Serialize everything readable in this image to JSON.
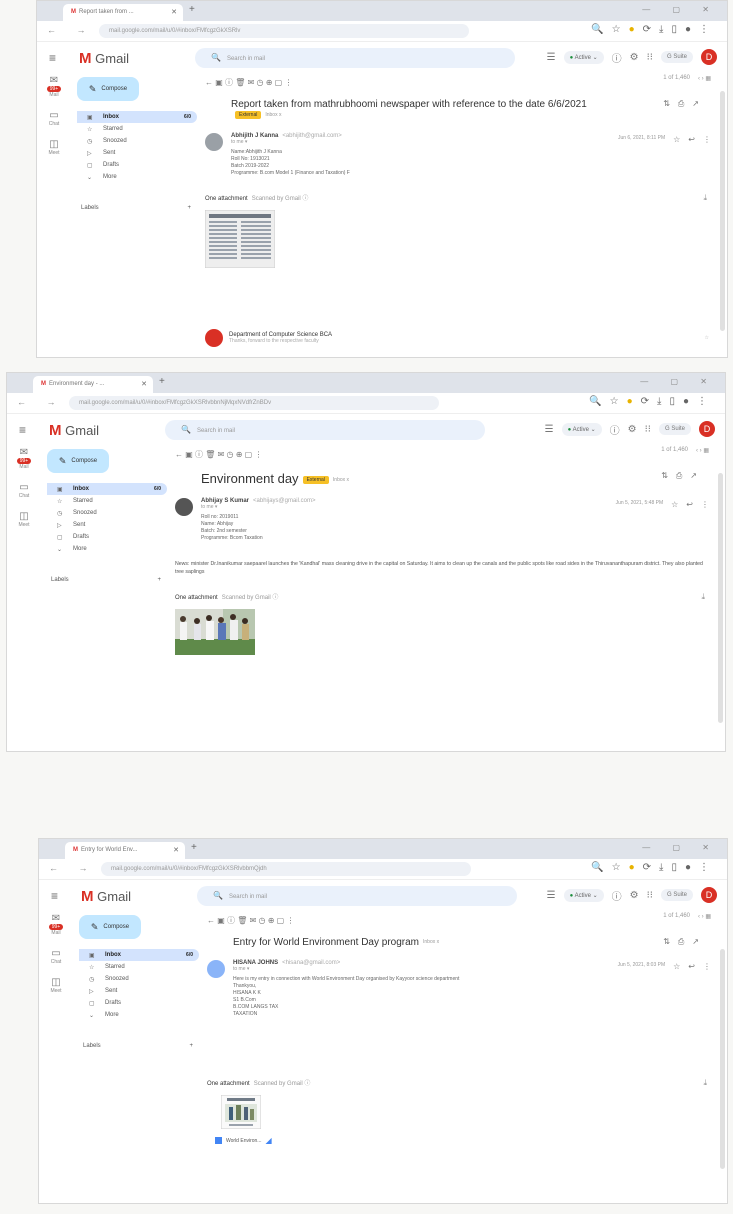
{
  "window": {
    "new_tab_symbol": "+",
    "controls": "— ▢ ✕",
    "nav": "← → ↻",
    "tune_icon": "☰"
  },
  "gmail": {
    "logo_text": "Gmail",
    "search_placeholder": "Search in mail",
    "active_label": "Active",
    "suite_label": "G Suite",
    "avatar_letter": "D",
    "compose_label": "Compose",
    "labels_heading": "Labels",
    "labels_add": "+",
    "rail": [
      {
        "label": "Mail",
        "badge": "99+"
      },
      {
        "label": "Chat"
      },
      {
        "label": "Meet"
      }
    ],
    "folders": [
      {
        "icon": "▣",
        "label": "Inbox",
        "count": "6/0"
      },
      {
        "icon": "☆",
        "label": "Starred"
      },
      {
        "icon": "◷",
        "label": "Snoozed"
      },
      {
        "icon": "▷",
        "label": "Sent"
      },
      {
        "icon": "▢",
        "label": "Drafts"
      },
      {
        "icon": "⌄",
        "label": "More"
      }
    ],
    "toolbar_icons": "← ▣ ⓘ 🗑 ✉ ◷ ⊕ ▢ ⋮",
    "pager": "1 of 1,460"
  },
  "screens": [
    {
      "tab_title": "Report taken from ...",
      "url": "mail.google.com/mail/u/0/#inbox/FMfcgzGkXSRlv",
      "subject": "Report taken from mathrubhoomi newspaper with reference to the date 6/6/2021",
      "label": "External",
      "label2": "Inbox x",
      "sender_name": "Abhijith J Kanna",
      "sender_addr": "<abhijith@gmail.com>",
      "to_line": "to me ▾",
      "body_lines": [
        "Name:Abhijith J Kanna",
        "Roll No: 1913021",
        "Batch 2019-2022",
        "Programme: B.com Model 1 (Finance and Taxation) F"
      ],
      "paragraph": "",
      "date": "Jun 6, 2021, 8:11 PM",
      "attachment_title": "One attachment",
      "attachment_note": "Scanned by Gmail ⓘ",
      "reply_name": "Department of Computer Science BCA",
      "reply_snippet": "Thanks, forward to the respective faculty"
    },
    {
      "tab_title": "Environment day - ...",
      "url": "mail.google.com/mail/u/0/#inbox/FMfcgzGkXSRlvbbnNjMqxNVdfrZnBDv",
      "subject": "Environment day",
      "label": "External",
      "label2": "Inbox x",
      "sender_name": "Abhijay S Kumar",
      "sender_addr": "<abhijays@gmail.com>",
      "to_line": "to me ▾",
      "body_lines": [
        "Roll no: 2019011",
        "Name: Abhijay",
        "Batch: 2nd semester",
        "Programme: Bcom Taxation"
      ],
      "paragraph": "News: minister Dr.Inanikumar saepaarel launches the 'Kandhal' mass cleaning drive in the capital on Saturday. It aims to clean up the canals and the public spots like road sides in the Thiruvananthapuram district. They also planted tree saplings",
      "date": "Jun 5, 2021, 5:48 PM",
      "attachment_title": "One attachment",
      "attachment_note": "Scanned by Gmail ⓘ"
    },
    {
      "tab_title": "Entry for World Env...",
      "url": "mail.google.com/mail/u/0/#inbox/FMfcgzGkXSRlvbbmQjdh",
      "subject": "Entry for World Environment Day program",
      "label": "",
      "label2": "Inbox x",
      "sender_name": "HISANA JOHNS",
      "sender_addr": "<hisana@gmail.com>",
      "to_line": "to me ▾",
      "body_lines": [
        "Here is my entry in connection with World Environment Day organised by Kayyoor science department",
        "",
        "Thankyou,",
        "HISANA K K",
        "S1 B.Com",
        "B.COM LANGS TAX",
        "TAXATION"
      ],
      "paragraph": "",
      "date": "Jun 5, 2021, 8:03 PM",
      "attachment_title": "One attachment",
      "attachment_note": "Scanned by Gmail ⓘ",
      "file_chip": "World Environ..."
    }
  ]
}
